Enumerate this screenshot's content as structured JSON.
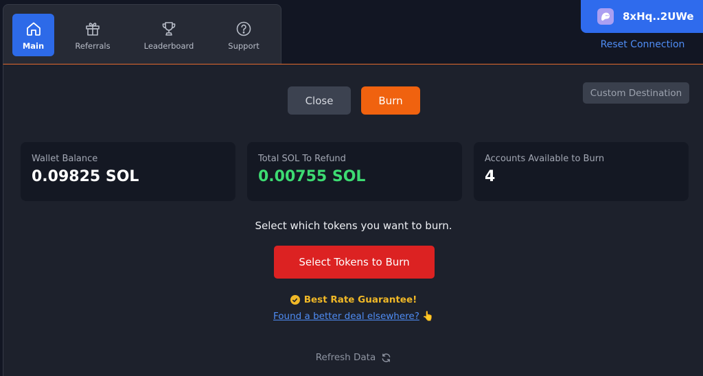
{
  "nav": {
    "items": [
      {
        "label": "Main",
        "icon": "home-icon",
        "active": true
      },
      {
        "label": "Referrals",
        "icon": "gift-icon",
        "active": false
      },
      {
        "label": "Leaderboard",
        "icon": "trophy-icon",
        "active": false
      },
      {
        "label": "Support",
        "icon": "question-circle-icon",
        "active": false
      }
    ]
  },
  "wallet": {
    "address": "8xHq..2UWe",
    "avatar_icon": "ghost-icon",
    "reset_label": "Reset Connection"
  },
  "actions": {
    "close_label": "Close",
    "burn_label": "Burn",
    "custom_destination_label": "Custom Destination"
  },
  "stats": {
    "wallet_balance": {
      "title": "Wallet Balance",
      "value": "0.09825 SOL"
    },
    "total_refund": {
      "title": "Total SOL To Refund",
      "value": "0.00755 SOL"
    },
    "accounts": {
      "title": "Accounts Available to Burn",
      "value": "4"
    }
  },
  "main": {
    "instruction": "Select which tokens you want to burn.",
    "select_button": "Select Tokens to Burn",
    "rate_guarantee": "Best Rate Guarantee!",
    "deal_link": "Found a better deal elsewhere?",
    "deal_emoji": "👆",
    "refresh_label": "Refresh Data"
  },
  "colors": {
    "accent_blue": "#2f6bed",
    "burn_orange": "#f0620f",
    "danger_red": "#dc2222",
    "success_green": "#3ddb72",
    "gold": "#f0b827"
  }
}
